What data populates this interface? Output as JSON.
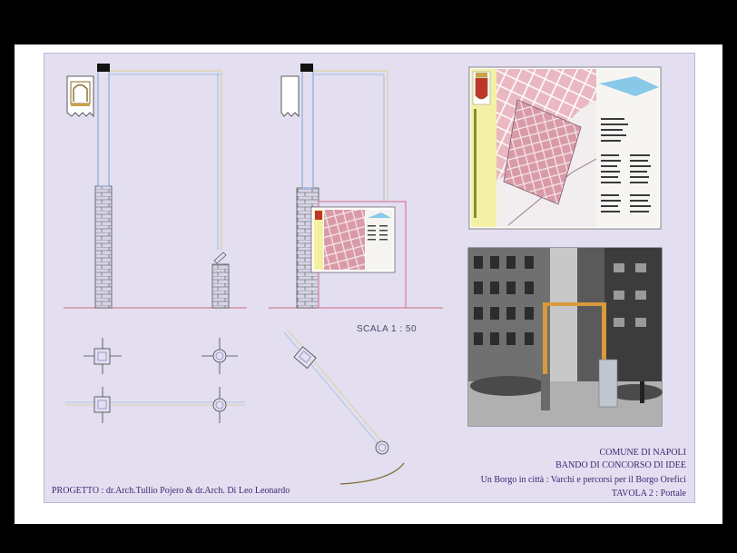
{
  "scale_label": "SCALA 1 : 50",
  "title_block": {
    "line1": "COMUNE DI NAPOLI",
    "line2": "BANDO DI CONCORSO DI IDEE",
    "line3": "Un Borgo in città : Varchi e percorsi per il Borgo Orefici",
    "line4": "TAVOLA 2 : Portale"
  },
  "project_credit": "PROGETTO : dr.Arch.Tullio Pojero & dr.Arch. Di Leo Leonardo",
  "colors": {
    "sheet": "#e3def0",
    "title_text": "#3a2a72",
    "brick": "#c9c9d9",
    "map_pink": "#e6b9c0",
    "map_bg": "#f3ecee",
    "portal_orange": "#d99a3c"
  }
}
